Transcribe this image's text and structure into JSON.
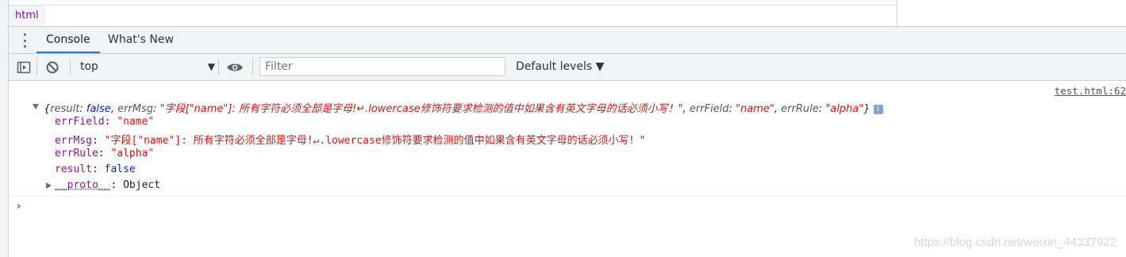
{
  "breadcrumb": {
    "item": "html"
  },
  "tabs": [
    {
      "label": "Console",
      "active": true
    },
    {
      "label": "What's New",
      "active": false
    }
  ],
  "toolbar": {
    "context": "top",
    "filter_placeholder": "Filter",
    "levels": "Default levels ▼"
  },
  "log": {
    "source": "test.html:62",
    "summary": {
      "open": "{",
      "k_result": "result",
      "v_result": "false",
      "k_errMsg": "errMsg",
      "v_errMsg": "\"字段[\"name\"]: 所有字符必须全部是字母!↵.lowercase修饰符要求检测的值中如果含有英文字母的话必须小写！\"",
      "k_errField": "errField",
      "v_errField": "\"name\"",
      "k_errRule": "errRule",
      "v_errRule": "\"alpha\"",
      "close": "}",
      "info": "i"
    },
    "props": [
      {
        "key": "errField",
        "value": "\"name\"",
        "type": "string"
      },
      {
        "key": "errMsg",
        "value": "\"字段[\"name\"]: 所有字符必须全部是字母!↵.lowercase修饰符要求检测的值中如果含有英文字母的话必须小写！\"",
        "type": "string"
      },
      {
        "key": "errRule",
        "value": "\"alpha\"",
        "type": "string"
      },
      {
        "key": "result",
        "value": "false",
        "type": "keyword"
      },
      {
        "key": "__proto__",
        "value": "Object",
        "type": "object"
      }
    ]
  },
  "prompt": "›",
  "watermark": "https://blog.csdn.net/weixin_44337922",
  "colors": {
    "string": "#c41a16",
    "keyword": "#0d22aa",
    "property": "#881391",
    "accent": "#1a73e8"
  }
}
